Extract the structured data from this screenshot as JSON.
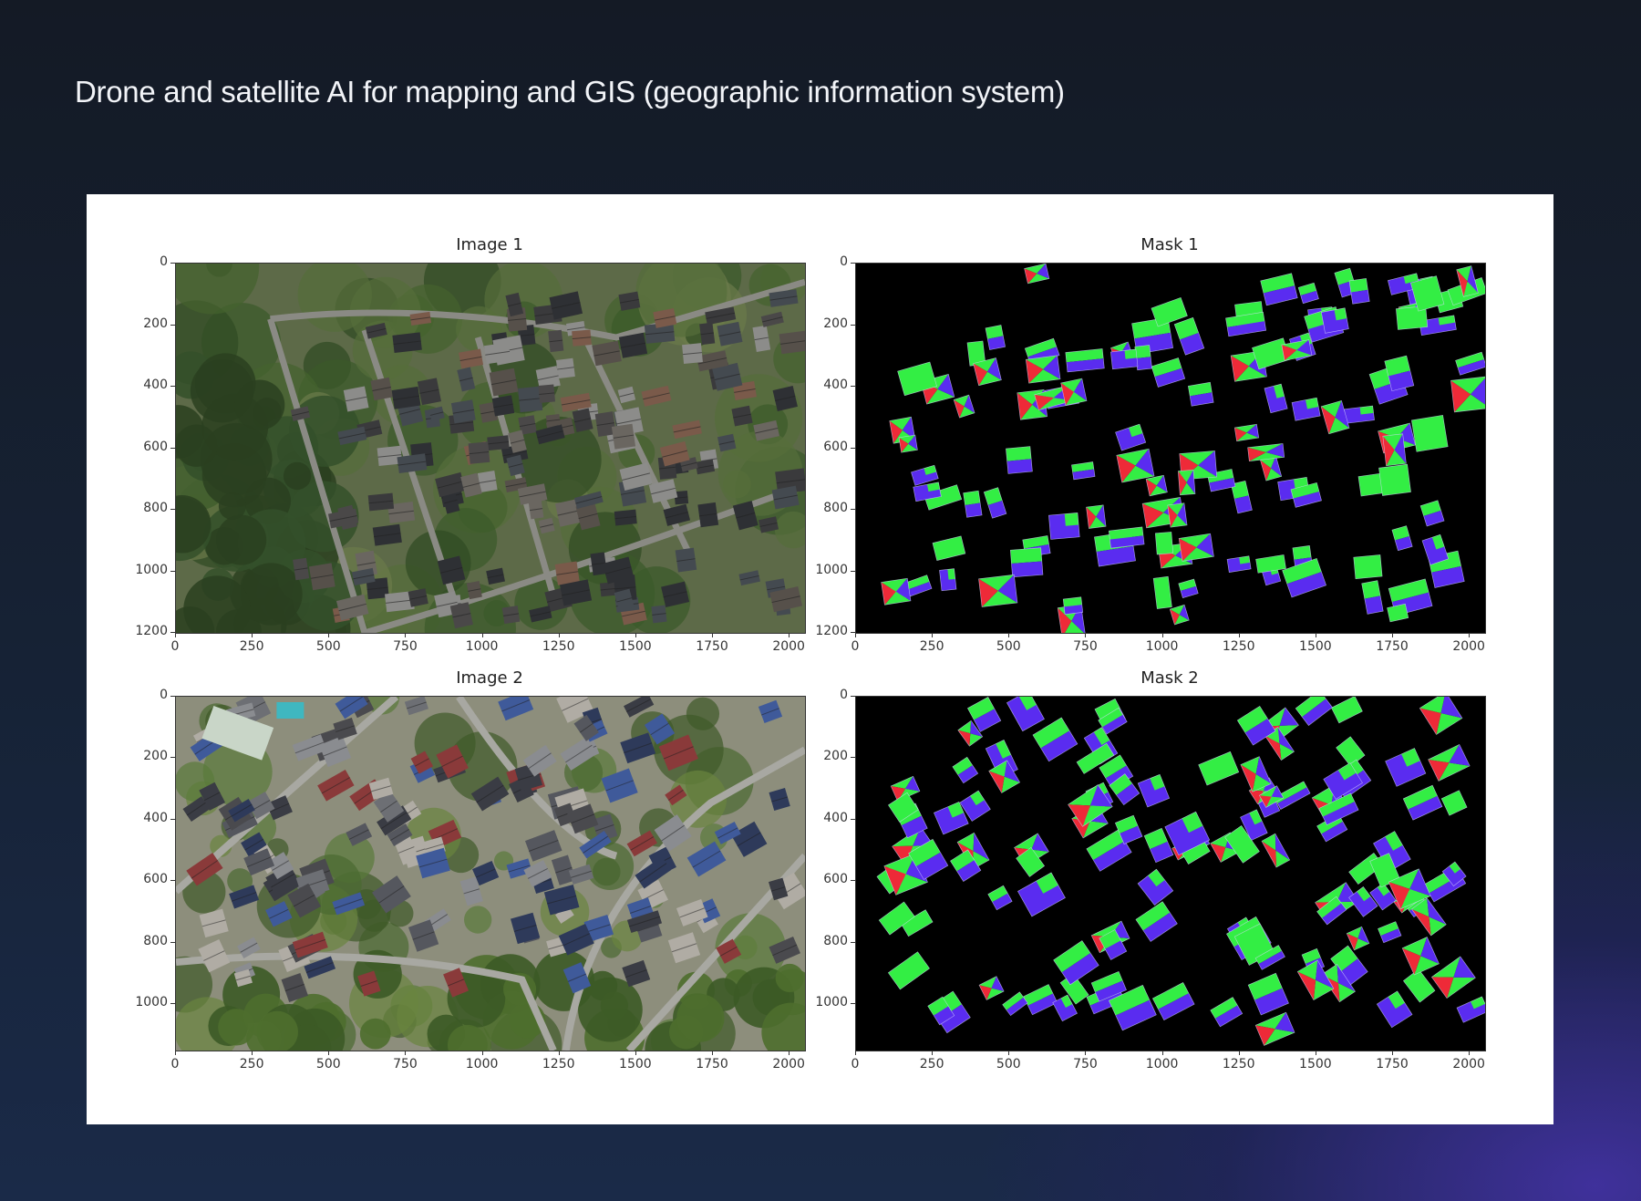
{
  "page": {
    "headline": "Drone and satellite AI for mapping and GIS (geographic information system)"
  },
  "colors": {
    "background_dark": "#141a25",
    "background_glow": "#4632aa",
    "figure_background": "#ffffff",
    "mask_background": "#000000",
    "mask_class_green": "#33ee44",
    "mask_class_blue": "#5a2cf0",
    "mask_class_red": "#ee2a38"
  },
  "panels": [
    {
      "title": "Image 1",
      "kind": "aerial-photo",
      "x_ticks": [
        "0",
        "250",
        "500",
        "750",
        "1000",
        "1250",
        "1500",
        "1750",
        "2000"
      ],
      "y_ticks": [
        "0",
        "200",
        "400",
        "600",
        "800",
        "1000",
        "1200"
      ]
    },
    {
      "title": "Mask 1",
      "kind": "segmentation-mask",
      "x_ticks": [
        "0",
        "250",
        "500",
        "750",
        "1000",
        "1250",
        "1500",
        "1750",
        "2000"
      ],
      "y_ticks": [
        "0",
        "200",
        "400",
        "600",
        "800",
        "1000",
        "1200"
      ]
    },
    {
      "title": "Image 2",
      "kind": "aerial-photo",
      "x_ticks": [
        "0",
        "250",
        "500",
        "750",
        "1000",
        "1250",
        "1500",
        "1750",
        "2000"
      ],
      "y_ticks": [
        "0",
        "200",
        "400",
        "600",
        "800",
        "1000"
      ]
    },
    {
      "title": "Mask 2",
      "kind": "segmentation-mask",
      "x_ticks": [
        "0",
        "250",
        "500",
        "750",
        "1000",
        "1250",
        "1500",
        "1750",
        "2000"
      ],
      "y_ticks": [
        "0",
        "200",
        "400",
        "600",
        "800",
        "1000"
      ]
    }
  ]
}
